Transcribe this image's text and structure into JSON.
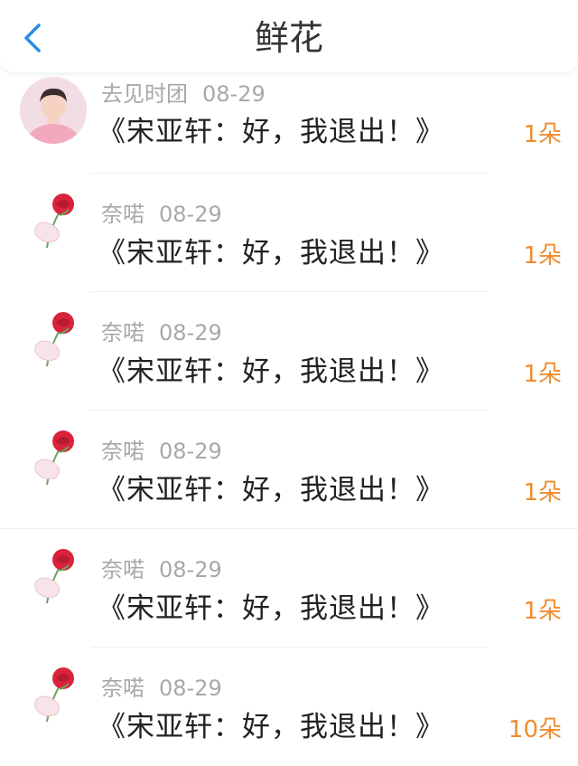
{
  "header": {
    "title": "鲜花"
  },
  "colors": {
    "accent": "#2b8ce6",
    "count": "#f08c2e",
    "meta": "#a8a8a8"
  },
  "items": [
    {
      "name": "去见时团",
      "date": "08-29",
      "message": "《宋亚轩：好，我退出！》",
      "count": "1朵"
    },
    {
      "name": "奈喏",
      "date": "08-29",
      "message": "《宋亚轩：好，我退出！》",
      "count": "1朵"
    },
    {
      "name": "奈喏",
      "date": "08-29",
      "message": "《宋亚轩：好，我退出！》",
      "count": "1朵"
    },
    {
      "name": "奈喏",
      "date": "08-29",
      "message": "《宋亚轩：好，我退出！》",
      "count": "1朵"
    },
    {
      "name": "奈喏",
      "date": "08-29",
      "message": "《宋亚轩：好，我退出！》",
      "count": "1朵"
    },
    {
      "name": "奈喏",
      "date": "08-29",
      "message": "《宋亚轩：好，我退出！》",
      "count": "10朵"
    }
  ]
}
